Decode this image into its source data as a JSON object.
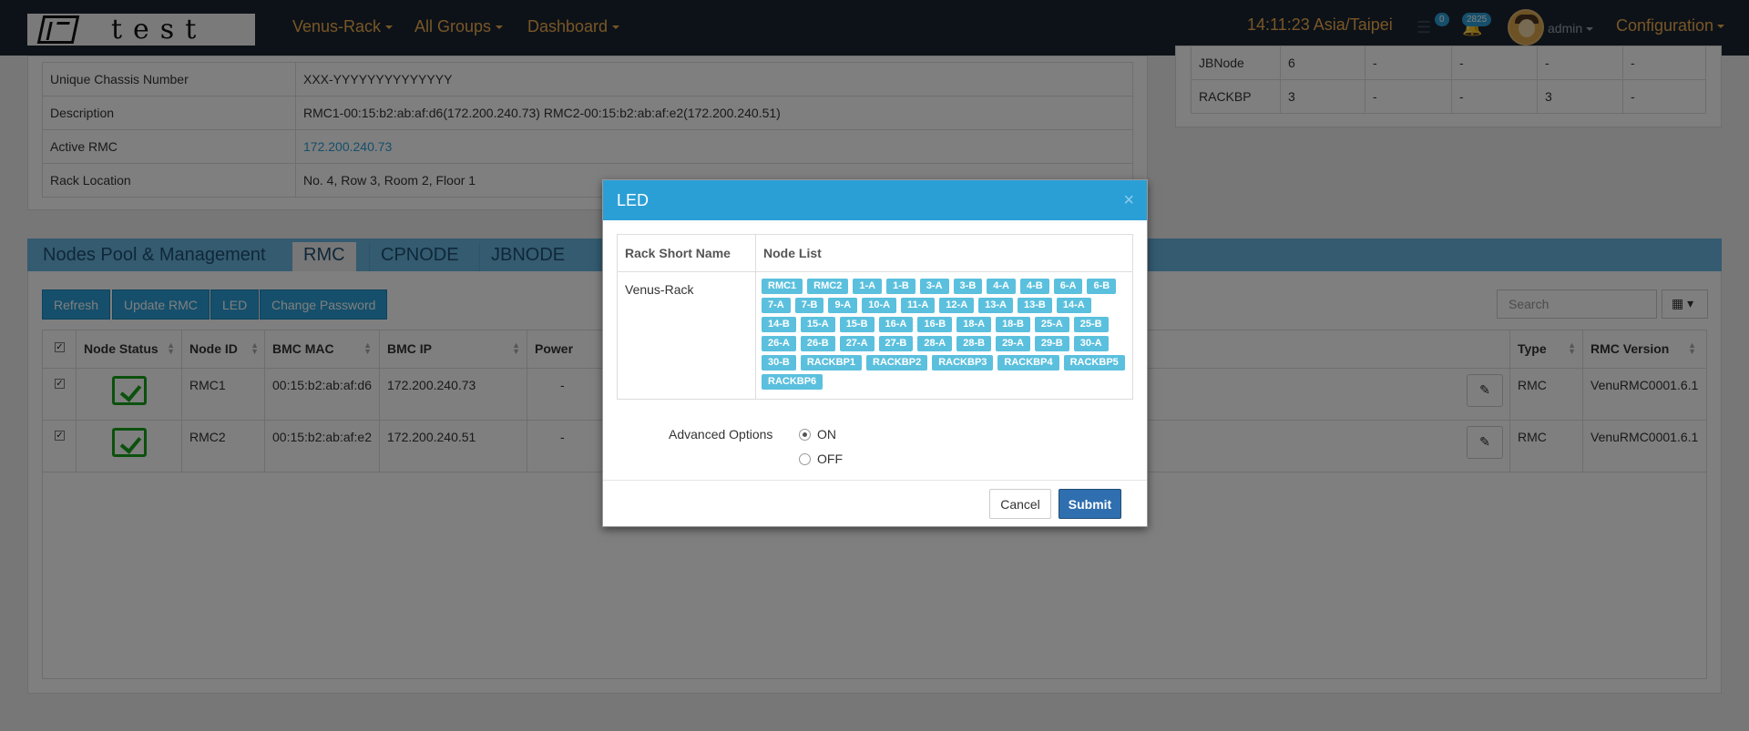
{
  "navbar": {
    "logo_text": "test",
    "menus": [
      "Venus-Rack",
      "All Groups",
      "Dashboard"
    ],
    "clock": "14:11:23 Asia/Taipei",
    "tasks_badge": "0",
    "alerts_badge": "2825",
    "user": "admin",
    "config": "Configuration"
  },
  "info": {
    "rows": [
      {
        "label": "Unique Chassis Number",
        "value": "XXX-YYYYYYYYYYYYYY"
      },
      {
        "label": "Description",
        "value": "RMC1-00:15:b2:ab:af:d6(172.200.240.73) RMC2-00:15:b2:ab:af:e2(172.200.240.51)"
      },
      {
        "label": "Active RMC",
        "value": "172.200.240.73"
      },
      {
        "label": "Rack Location",
        "value": "No. 4, Row 3, Room 2, Floor 1"
      }
    ]
  },
  "summary": {
    "rows": [
      [
        "JBNode",
        "6",
        "-",
        "-",
        "-",
        "-"
      ],
      [
        "RACKBP",
        "3",
        "-",
        "-",
        "3",
        "-"
      ]
    ]
  },
  "tabs": [
    "Nodes Pool & Management",
    "RMC",
    "CPNODE",
    "JBNODE"
  ],
  "toolbar": {
    "refresh": "Refresh",
    "update_rmc": "Update RMC",
    "led": "LED",
    "change_password": "Change Password",
    "search_placeholder": "Search"
  },
  "table": {
    "headers": [
      "Node Status",
      "Node ID",
      "BMC MAC",
      "BMC IP",
      "Power",
      "Type",
      "RMC Version"
    ],
    "rows": [
      {
        "id": "RMC1",
        "mac": "00:15:b2:ab:af:d6",
        "ip": "172.200.240.73",
        "power": "-",
        "type": "RMC",
        "version": "VenuRMC0001.6.1"
      },
      {
        "id": "RMC2",
        "mac": "00:15:b2:ab:af:e2",
        "ip": "172.200.240.51",
        "power": "-",
        "type": "RMC",
        "version": "VenuRMC0001.6.1"
      }
    ]
  },
  "modal": {
    "title": "LED",
    "close": "×",
    "col_rack": "Rack Short Name",
    "col_nodes": "Node List",
    "rack": "Venus-Rack",
    "nodes": [
      "RMC1",
      "RMC2",
      "1-A",
      "1-B",
      "3-A",
      "3-B",
      "4-A",
      "4-B",
      "6-A",
      "6-B",
      "7-A",
      "7-B",
      "9-A",
      "10-A",
      "11-A",
      "12-A",
      "13-A",
      "13-B",
      "14-A",
      "14-B",
      "15-A",
      "15-B",
      "16-A",
      "16-B",
      "18-A",
      "18-B",
      "25-A",
      "25-B",
      "26-A",
      "26-B",
      "27-A",
      "27-B",
      "28-A",
      "28-B",
      "29-A",
      "29-B",
      "30-A",
      "30-B",
      "RACKBP1",
      "RACKBP2",
      "RACKBP3",
      "RACKBP4",
      "RACKBP5",
      "RACKBP6"
    ],
    "adv_label": "Advanced Options",
    "opt_on": "ON",
    "opt_off": "OFF",
    "selected": "ON",
    "cancel": "Cancel",
    "submit": "Submit"
  },
  "colors": {
    "navbar": "#1b2531",
    "accent": "#f0ad4e",
    "primary": "#2a9fd6",
    "node_tag": "#5bc0de",
    "submit": "#2f6fb0",
    "status_ok": "#16a21b"
  }
}
